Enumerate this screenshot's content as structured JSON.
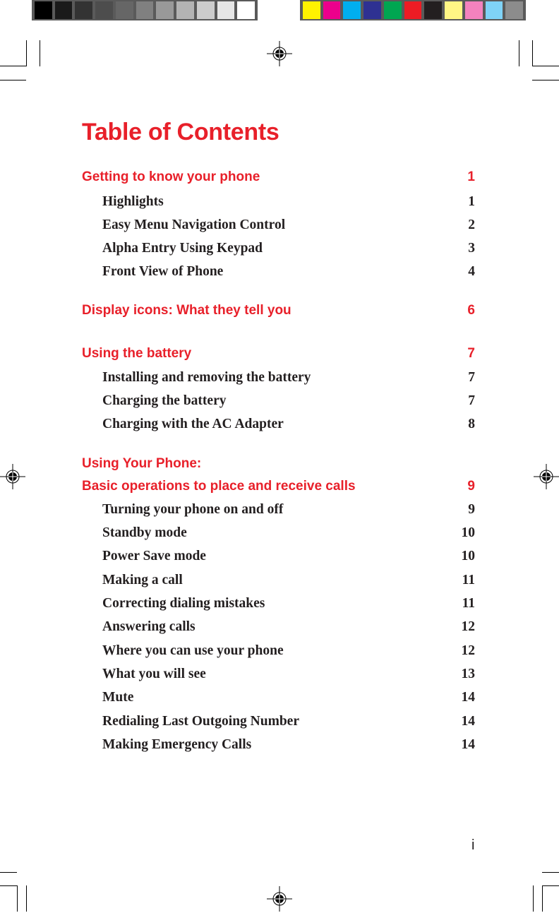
{
  "print_marks": {
    "gray_swatches": [
      "#000000",
      "#1a1a1a",
      "#333333",
      "#4d4d4d",
      "#666666",
      "#808080",
      "#999999",
      "#b3b3b3",
      "#cccccc",
      "#e6e6e6",
      "#ffffff"
    ],
    "color_swatches": [
      "#fff200",
      "#ec008c",
      "#00aeef",
      "#2e3192",
      "#00a651",
      "#ed1c24",
      "#231f20",
      "#fff685",
      "#f482be",
      "#7fd3f7",
      "#8c8c8c"
    ]
  },
  "colors": {
    "heading": "#e8202a",
    "text": "#231f20"
  },
  "document": {
    "title": "Table of Contents",
    "entries": [
      {
        "level": "section",
        "label": "Getting to know your phone",
        "page": "1"
      },
      {
        "level": "sub",
        "label": "Highlights",
        "page": "1"
      },
      {
        "level": "sub",
        "label": "Easy Menu Navigation Control",
        "page": "2"
      },
      {
        "level": "sub",
        "label": "Alpha Entry Using Keypad",
        "page": "3"
      },
      {
        "level": "sub",
        "label": "Front View of Phone",
        "page": "4"
      },
      {
        "level": "section",
        "label": "Display icons: What they tell you",
        "page": "6"
      },
      {
        "level": "section",
        "label": "Using the battery",
        "page": "7"
      },
      {
        "level": "sub",
        "label": "Installing and removing the battery",
        "page": "7"
      },
      {
        "level": "sub",
        "label": "Charging the battery",
        "page": "7"
      },
      {
        "level": "sub",
        "label": "Charging with the AC Adapter",
        "page": "8"
      },
      {
        "level": "section",
        "label": "Using Your Phone:",
        "page": ""
      },
      {
        "level": "section",
        "label": "Basic operations to place and receive calls",
        "page": "9"
      },
      {
        "level": "sub",
        "label": "Turning your phone on and off",
        "page": "9"
      },
      {
        "level": "sub",
        "label": "Standby mode",
        "page": "10"
      },
      {
        "level": "sub",
        "label": "Power Save mode",
        "page": "10"
      },
      {
        "level": "sub",
        "label": "Making a call",
        "page": "11"
      },
      {
        "level": "sub",
        "label": "Correcting dialing mistakes",
        "page": "11"
      },
      {
        "level": "sub",
        "label": "Answering calls",
        "page": "12"
      },
      {
        "level": "sub",
        "label": "Where you can use your phone",
        "page": "12"
      },
      {
        "level": "sub",
        "label": "What you will see",
        "page": "13"
      },
      {
        "level": "sub",
        "label": "Mute",
        "page": "14"
      },
      {
        "level": "sub",
        "label": "Redialing Last Outgoing Number",
        "page": "14"
      },
      {
        "level": "sub",
        "label": "Making Emergency Calls",
        "page": "14"
      }
    ],
    "page_number": "i"
  }
}
